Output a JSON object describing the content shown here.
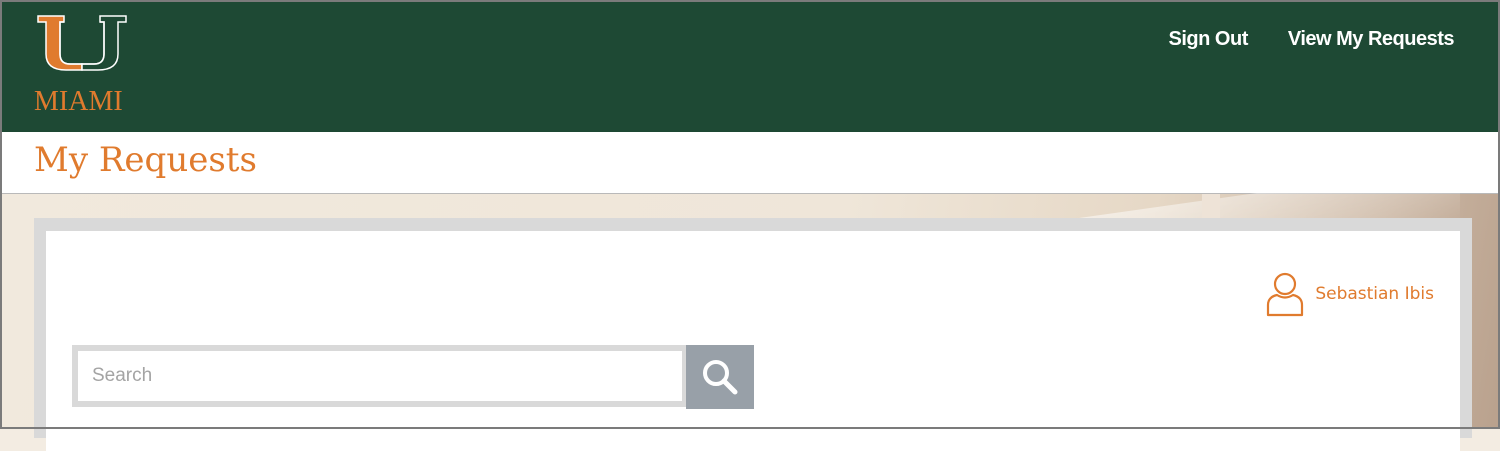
{
  "brand": {
    "wordmark": "MIAMI",
    "colors": {
      "green": "#1e4934",
      "orange": "#e07b2e"
    }
  },
  "nav": {
    "sign_out": "Sign Out",
    "view_requests": "View My Requests"
  },
  "page": {
    "title": "My Requests"
  },
  "user": {
    "name": "Sebastian Ibis",
    "icon": "user-icon"
  },
  "search": {
    "placeholder": "Search",
    "value": "",
    "button_icon": "search-icon"
  }
}
